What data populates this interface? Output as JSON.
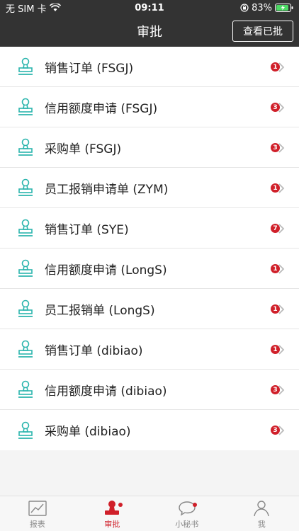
{
  "status": {
    "carrier": "无 SIM 卡",
    "time": "09:11",
    "battery": "83%"
  },
  "nav": {
    "title": "审批",
    "view_approved": "查看已批"
  },
  "items": [
    {
      "label": "销售订单 (FSGJ)",
      "badge": "1"
    },
    {
      "label": "信用额度申请 (FSGJ)",
      "badge": "3"
    },
    {
      "label": "采购单 (FSGJ)",
      "badge": "3"
    },
    {
      "label": "员工报销申请单 (ZYM)",
      "badge": "1"
    },
    {
      "label": "销售订单 (SYE)",
      "badge": "7"
    },
    {
      "label": "信用额度申请 (LongS)",
      "badge": "1"
    },
    {
      "label": "员工报销单 (LongS)",
      "badge": "1"
    },
    {
      "label": "销售订单 (dibiao)",
      "badge": "1"
    },
    {
      "label": "信用额度申请 (dibiao)",
      "badge": "3"
    },
    {
      "label": "采购单 (dibiao)",
      "badge": "3"
    }
  ],
  "tabs": [
    {
      "label": "报表",
      "icon": "chart-icon"
    },
    {
      "label": "审批",
      "icon": "stamp-icon"
    },
    {
      "label": "小秘书",
      "icon": "chat-icon"
    },
    {
      "label": "我",
      "icon": "person-icon"
    }
  ],
  "colors": {
    "accent": "#d0202a",
    "icon": "#2bb5ad",
    "navbar": "#333333"
  }
}
